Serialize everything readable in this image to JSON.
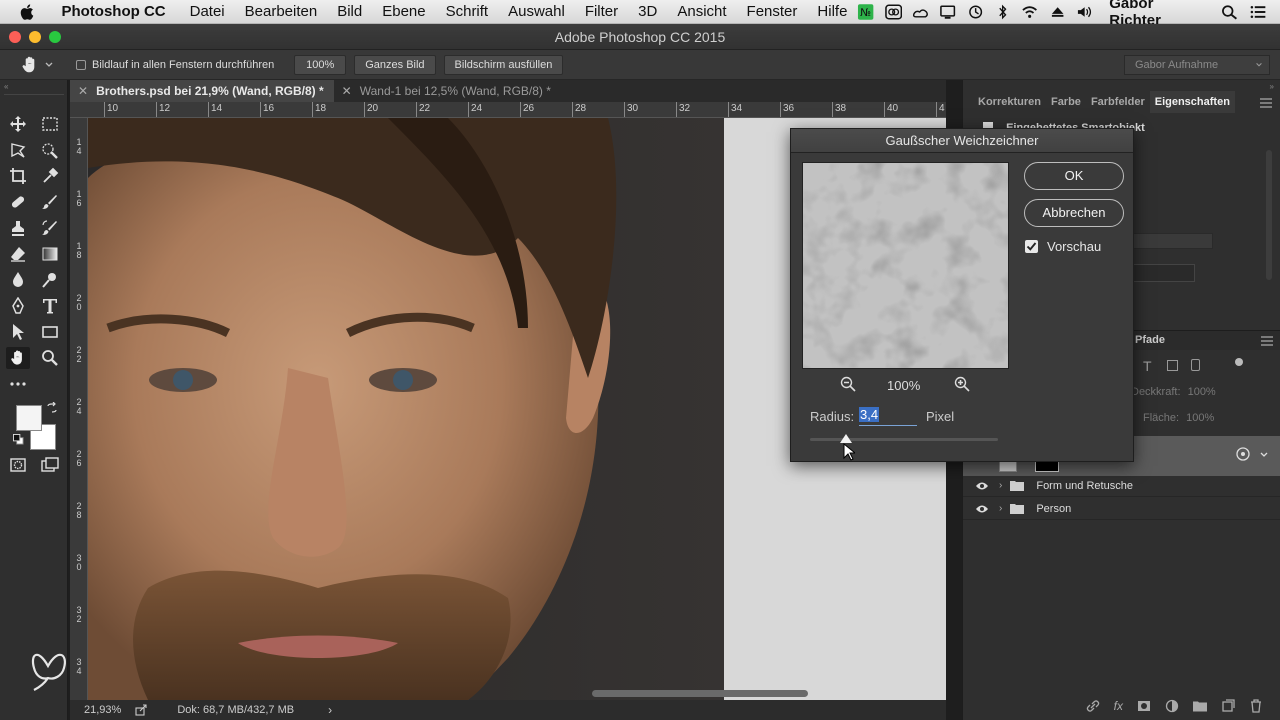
{
  "menubar": {
    "app_name": "Photoshop CC",
    "menus": [
      "Datei",
      "Bearbeiten",
      "Bild",
      "Ebene",
      "Schrift",
      "Auswahl",
      "Filter",
      "3D",
      "Ansicht",
      "Fenster",
      "Hilfe"
    ],
    "user_name": "Gabor Richter"
  },
  "window": {
    "title": "Adobe Photoshop CC 2015"
  },
  "options_bar": {
    "scroll_all_label": "Bildlauf in allen Fenstern durchführen",
    "zoom_100_label": "100%",
    "fit_screen_label": "Ganzes Bild",
    "fill_screen_label": "Bildschirm ausfüllen",
    "workspace_label": "Gabor Aufnahme"
  },
  "documents": {
    "tabs": [
      {
        "label": "Brothers.psd bei 21,9% (Wand, RGB/8) *",
        "active": true
      },
      {
        "label": "Wand-1 bei 12,5% (Wand, RGB/8) *",
        "active": false
      }
    ],
    "ruler_top": [
      "10",
      "12",
      "14",
      "16",
      "18",
      "20",
      "22",
      "24",
      "26",
      "28",
      "30",
      "32",
      "34",
      "36",
      "38",
      "40",
      "42",
      "4"
    ],
    "ruler_left": [
      "1\n4",
      "1\n6",
      "1\n8",
      "2\n0",
      "2\n2",
      "2\n4",
      "2\n6",
      "2\n8",
      "3\n0",
      "3\n2",
      "3\n4"
    ]
  },
  "status_bar": {
    "zoom": "21,93%",
    "doc_info": "Dok: 68,7 MB/432,7 MB"
  },
  "right_panel": {
    "tabs": [
      "Korrekturen",
      "Farbe",
      "Farbfelder",
      "Eigenschaften"
    ],
    "properties_title": "Eingebettetes Smartobjekt",
    "layers_tab_label": "Pfade",
    "opacity_label": "Deckkraft:",
    "opacity_value": "100%",
    "fill_label": "Fläche:",
    "fill_value": "100%",
    "layers": [
      {
        "name": "Form und Retusche"
      },
      {
        "name": "Person"
      }
    ]
  },
  "dialog": {
    "title": "Gaußscher Weichzeichner",
    "ok_label": "OK",
    "cancel_label": "Abbrechen",
    "preview_label": "Vorschau",
    "preview_checked": true,
    "zoom_label": "100%",
    "radius_label": "Radius:",
    "radius_value": "3,4",
    "radius_unit": "Pixel",
    "slider_value_fraction": 0.19
  }
}
